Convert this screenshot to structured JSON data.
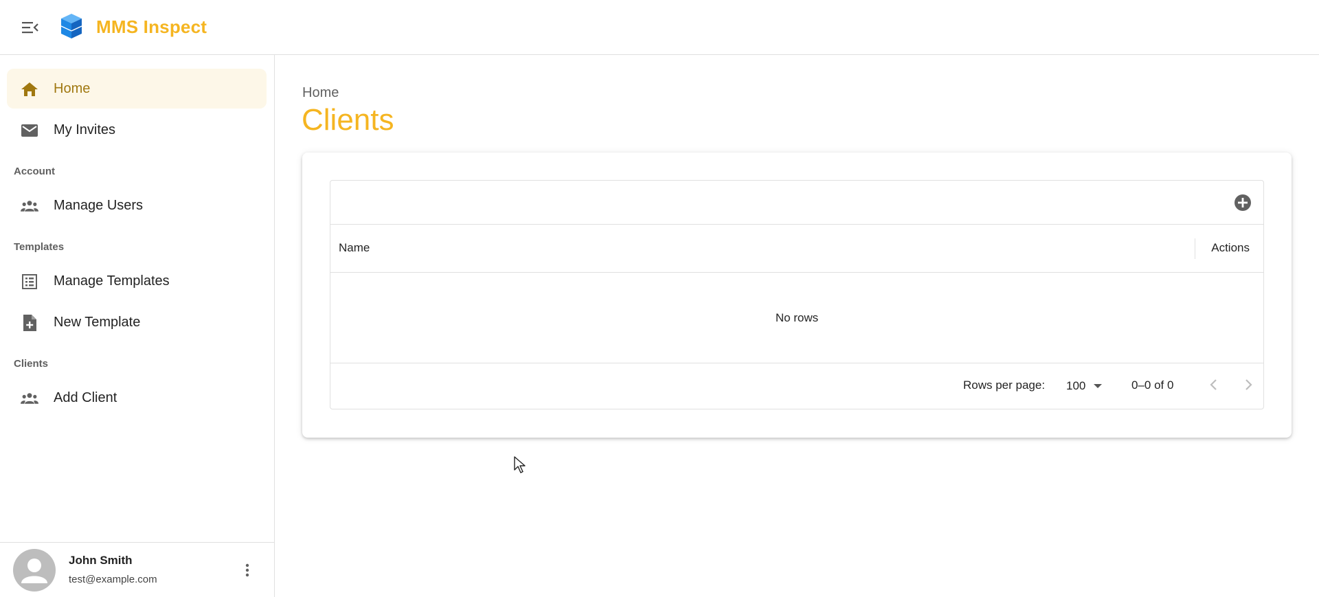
{
  "app": {
    "title": "MMS Inspect",
    "brand_color": "#f5b521"
  },
  "sidebar": {
    "items": [
      {
        "label": "Home",
        "icon": "home-icon",
        "active": true
      },
      {
        "label": "My Invites",
        "icon": "mail-icon",
        "active": false
      }
    ],
    "sections": [
      {
        "label": "Account",
        "items": [
          {
            "label": "Manage Users",
            "icon": "people-icon"
          }
        ]
      },
      {
        "label": "Templates",
        "items": [
          {
            "label": "Manage Templates",
            "icon": "list-icon"
          },
          {
            "label": "New Template",
            "icon": "file-plus-icon"
          }
        ]
      },
      {
        "label": "Clients",
        "items": [
          {
            "label": "Add Client",
            "icon": "people-icon"
          }
        ]
      }
    ],
    "user": {
      "name": "John Smith",
      "email": "test@example.com"
    }
  },
  "main": {
    "breadcrumb": "Home",
    "title": "Clients",
    "grid": {
      "columns": [
        "Name",
        "Actions"
      ],
      "empty_text": "No rows",
      "rows_per_page_label": "Rows per page:",
      "rows_per_page": "100",
      "page_range": "0–0 of 0"
    }
  }
}
